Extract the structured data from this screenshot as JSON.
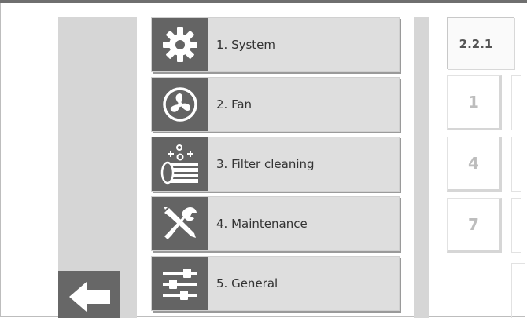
{
  "colors": {
    "icon_background": "#646464",
    "menu_background": "#dedede",
    "panel_gray": "#d6d6d6",
    "key_text": "#bdbdbd"
  },
  "menu": {
    "items": [
      {
        "label": "1. System",
        "icon": "gear-icon"
      },
      {
        "label": "2. Fan",
        "icon": "fan-icon"
      },
      {
        "label": "3. Filter cleaning",
        "icon": "filter-cleaning-icon"
      },
      {
        "label": "4. Maintenance",
        "icon": "tools-icon"
      },
      {
        "label": "5. General",
        "icon": "sliders-icon"
      }
    ]
  },
  "navigation": {
    "back_icon": "arrow-left-icon"
  },
  "menu_id": {
    "value": "2.2.1"
  },
  "keypad": {
    "keys": [
      "1",
      "4",
      "7"
    ]
  }
}
